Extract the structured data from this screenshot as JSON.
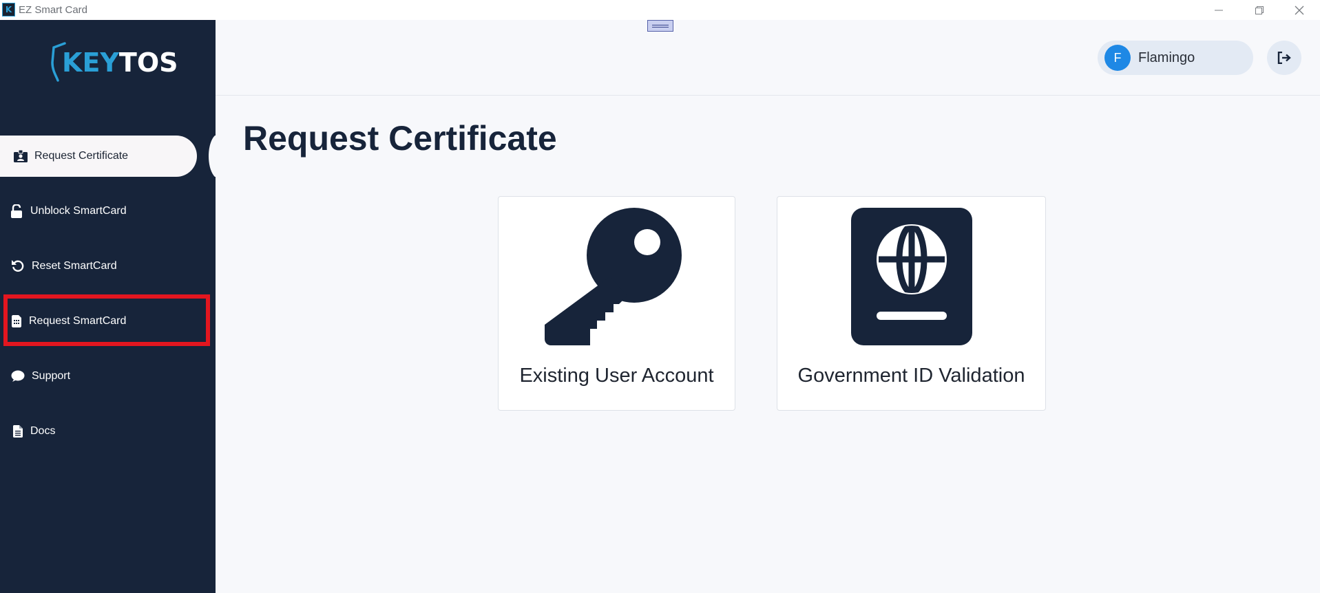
{
  "window": {
    "title": "EZ Smart Card",
    "app_icon_letter": "K"
  },
  "sidebar": {
    "logo": {
      "part1": "KEY",
      "part2": "TOS"
    },
    "items": [
      {
        "label": "Request Certificate",
        "icon": "id-badge-icon",
        "active": true
      },
      {
        "label": "Unblock SmartCard",
        "icon": "unlock-icon"
      },
      {
        "label": "Reset SmartCard",
        "icon": "undo-icon"
      },
      {
        "label": "Request SmartCard",
        "icon": "sim-card-icon",
        "highlighted": true
      },
      {
        "label": "Support",
        "icon": "chat-bubble-icon"
      },
      {
        "label": "Docs",
        "icon": "document-icon"
      }
    ]
  },
  "header": {
    "user": {
      "initial": "F",
      "name": "Flamingo"
    },
    "logout_icon": "logout-icon"
  },
  "main": {
    "title": "Request Certificate",
    "cards": [
      {
        "label": "Existing User Account",
        "icon": "key-icon"
      },
      {
        "label": "Government ID Validation",
        "icon": "passport-icon"
      }
    ]
  },
  "colors": {
    "sidebar_bg": "#17243a",
    "accent": "#2a9fd6",
    "highlight": "#e3161f",
    "avatar": "#1e88e5"
  }
}
